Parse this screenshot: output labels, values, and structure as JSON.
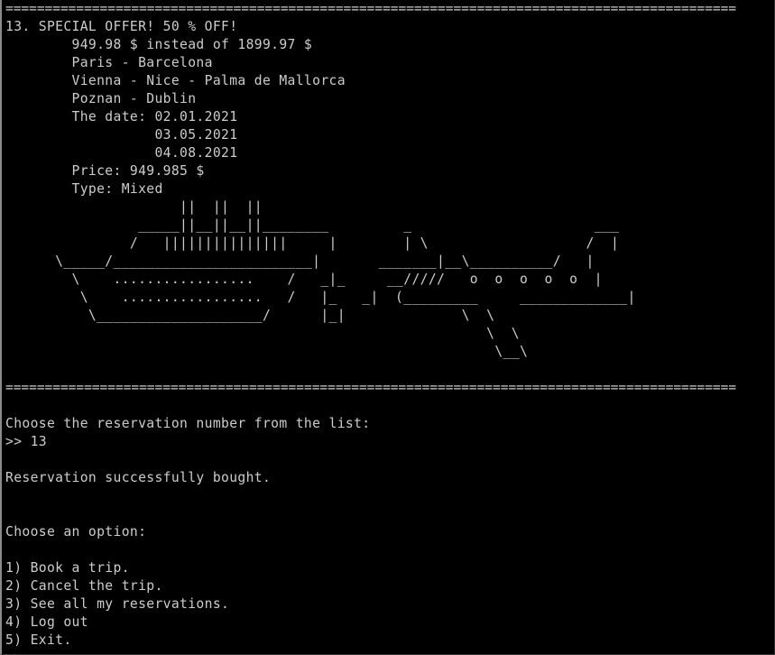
{
  "window": {
    "separator": "============================================================================================="
  },
  "offer": {
    "heading": "13. SPECIAL OFFER! 50 % OFF!",
    "price_line": "        949.98 $ instead of 1899.97 $",
    "routes": [
      "        Paris - Barcelona",
      "        Vienna - Nice - Palma de Mallorca",
      "        Poznan - Dublin"
    ],
    "date_line": "        The date: 02.01.2021",
    "dates_extra": [
      "                  03.05.2021",
      "                  04.08.2021"
    ],
    "price_detail": "        Price: 949.985 $",
    "type_line": "        Type: Mixed"
  },
  "ascii_art": [
    "                     ||  ||  ||",
    "                _____||__||__||________         _                      ___",
    "               /   |||||||||||||||     |        | \\                   /  |",
    "      \\_____/________________________|       _______|__\\__________/   |",
    "        \\    .................    /   _|_     __/////   o  o  o  o  o  |",
    "         \\    .................   /   |_   _|  (_________     _____________|",
    "          \\____________________/      |_|              \\  \\",
    "                                                          \\  \\",
    "                                                           \\__\\"
  ],
  "session": {
    "prompt_reservation": "Choose the reservation number from the list:",
    "input_echo": ">> 13",
    "result": "Reservation successfully bought.",
    "choose_option": "Choose an option:",
    "menu": [
      "1) Book a trip.",
      "2) Cancel the trip.",
      "3) See all my reservations.",
      "4) Log out",
      "5) Exit."
    ],
    "final_prompt": ">>"
  }
}
